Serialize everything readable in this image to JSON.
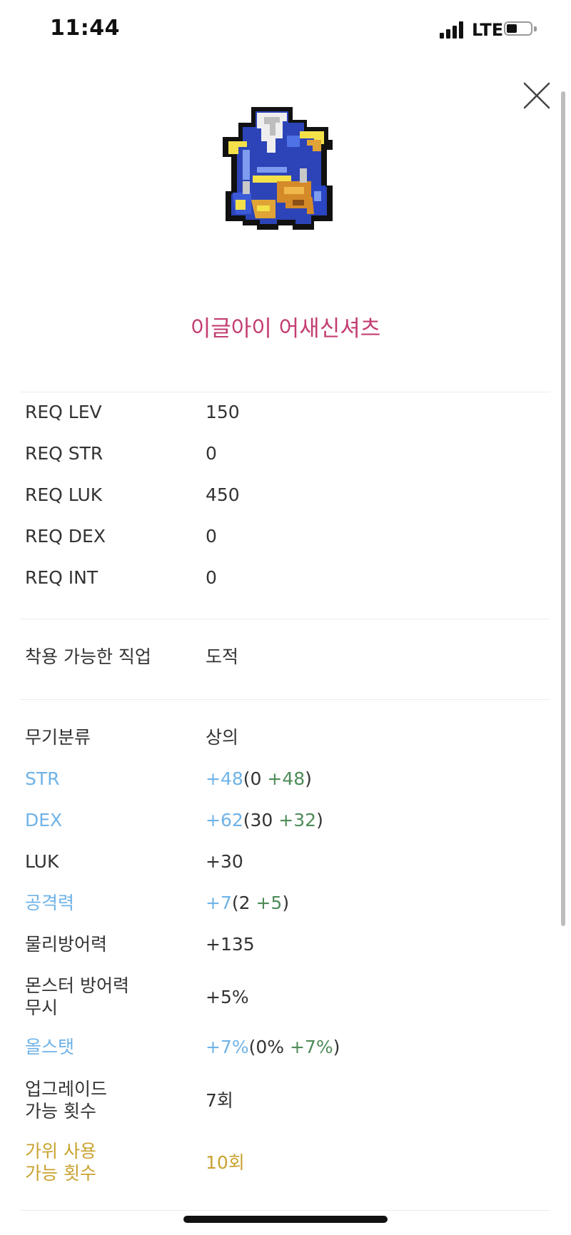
{
  "status_bar": {
    "time": "11:44",
    "network": "LTE"
  },
  "item": {
    "name": "이글아이 어새신셔츠"
  },
  "requirements": [
    {
      "label": "REQ LEV",
      "value": "150"
    },
    {
      "label": "REQ STR",
      "value": "0"
    },
    {
      "label": "REQ LUK",
      "value": "450"
    },
    {
      "label": "REQ DEX",
      "value": "0"
    },
    {
      "label": "REQ INT",
      "value": "0"
    }
  ],
  "job": {
    "label": "착용 가능한 직업",
    "value": "도적"
  },
  "stats": {
    "category": {
      "label": "무기분류",
      "value": "상의"
    },
    "str": {
      "label": "STR",
      "total": "+48",
      "open": "(",
      "base": "0",
      "bonus": "+48",
      "close": ")"
    },
    "dex": {
      "label": "DEX",
      "total": "+62",
      "open": "(",
      "base": "30",
      "bonus": "+32",
      "close": ")"
    },
    "luk": {
      "label": "LUK",
      "value": "+30"
    },
    "attack": {
      "label": "공격력",
      "total": "+7",
      "open": "(",
      "base": "2",
      "bonus": "+5",
      "close": ")"
    },
    "defense": {
      "label": "물리방어력",
      "value": "+135"
    },
    "ignore_def": {
      "label_line1": "몬스터 방어력",
      "label_line2": "무시",
      "value": "+5%"
    },
    "allstat": {
      "label": "올스탯",
      "total": "+7%",
      "open": "(",
      "base": "0%",
      "bonus": "+7%",
      "close": ")"
    },
    "upgrades": {
      "label_line1": "업그레이드",
      "label_line2": "가능 횟수",
      "value": "7회"
    },
    "scissors": {
      "label_line1": "가위 사용",
      "label_line2": "가능 횟수",
      "value": "10회"
    }
  },
  "colors": {
    "name": "#c33d72",
    "enhanced": "#6fb3e8",
    "bonus": "#4f8b58",
    "scissors": "#c9a22f"
  },
  "icons": {
    "close": "close-icon",
    "item": "armor-sprite-icon"
  }
}
